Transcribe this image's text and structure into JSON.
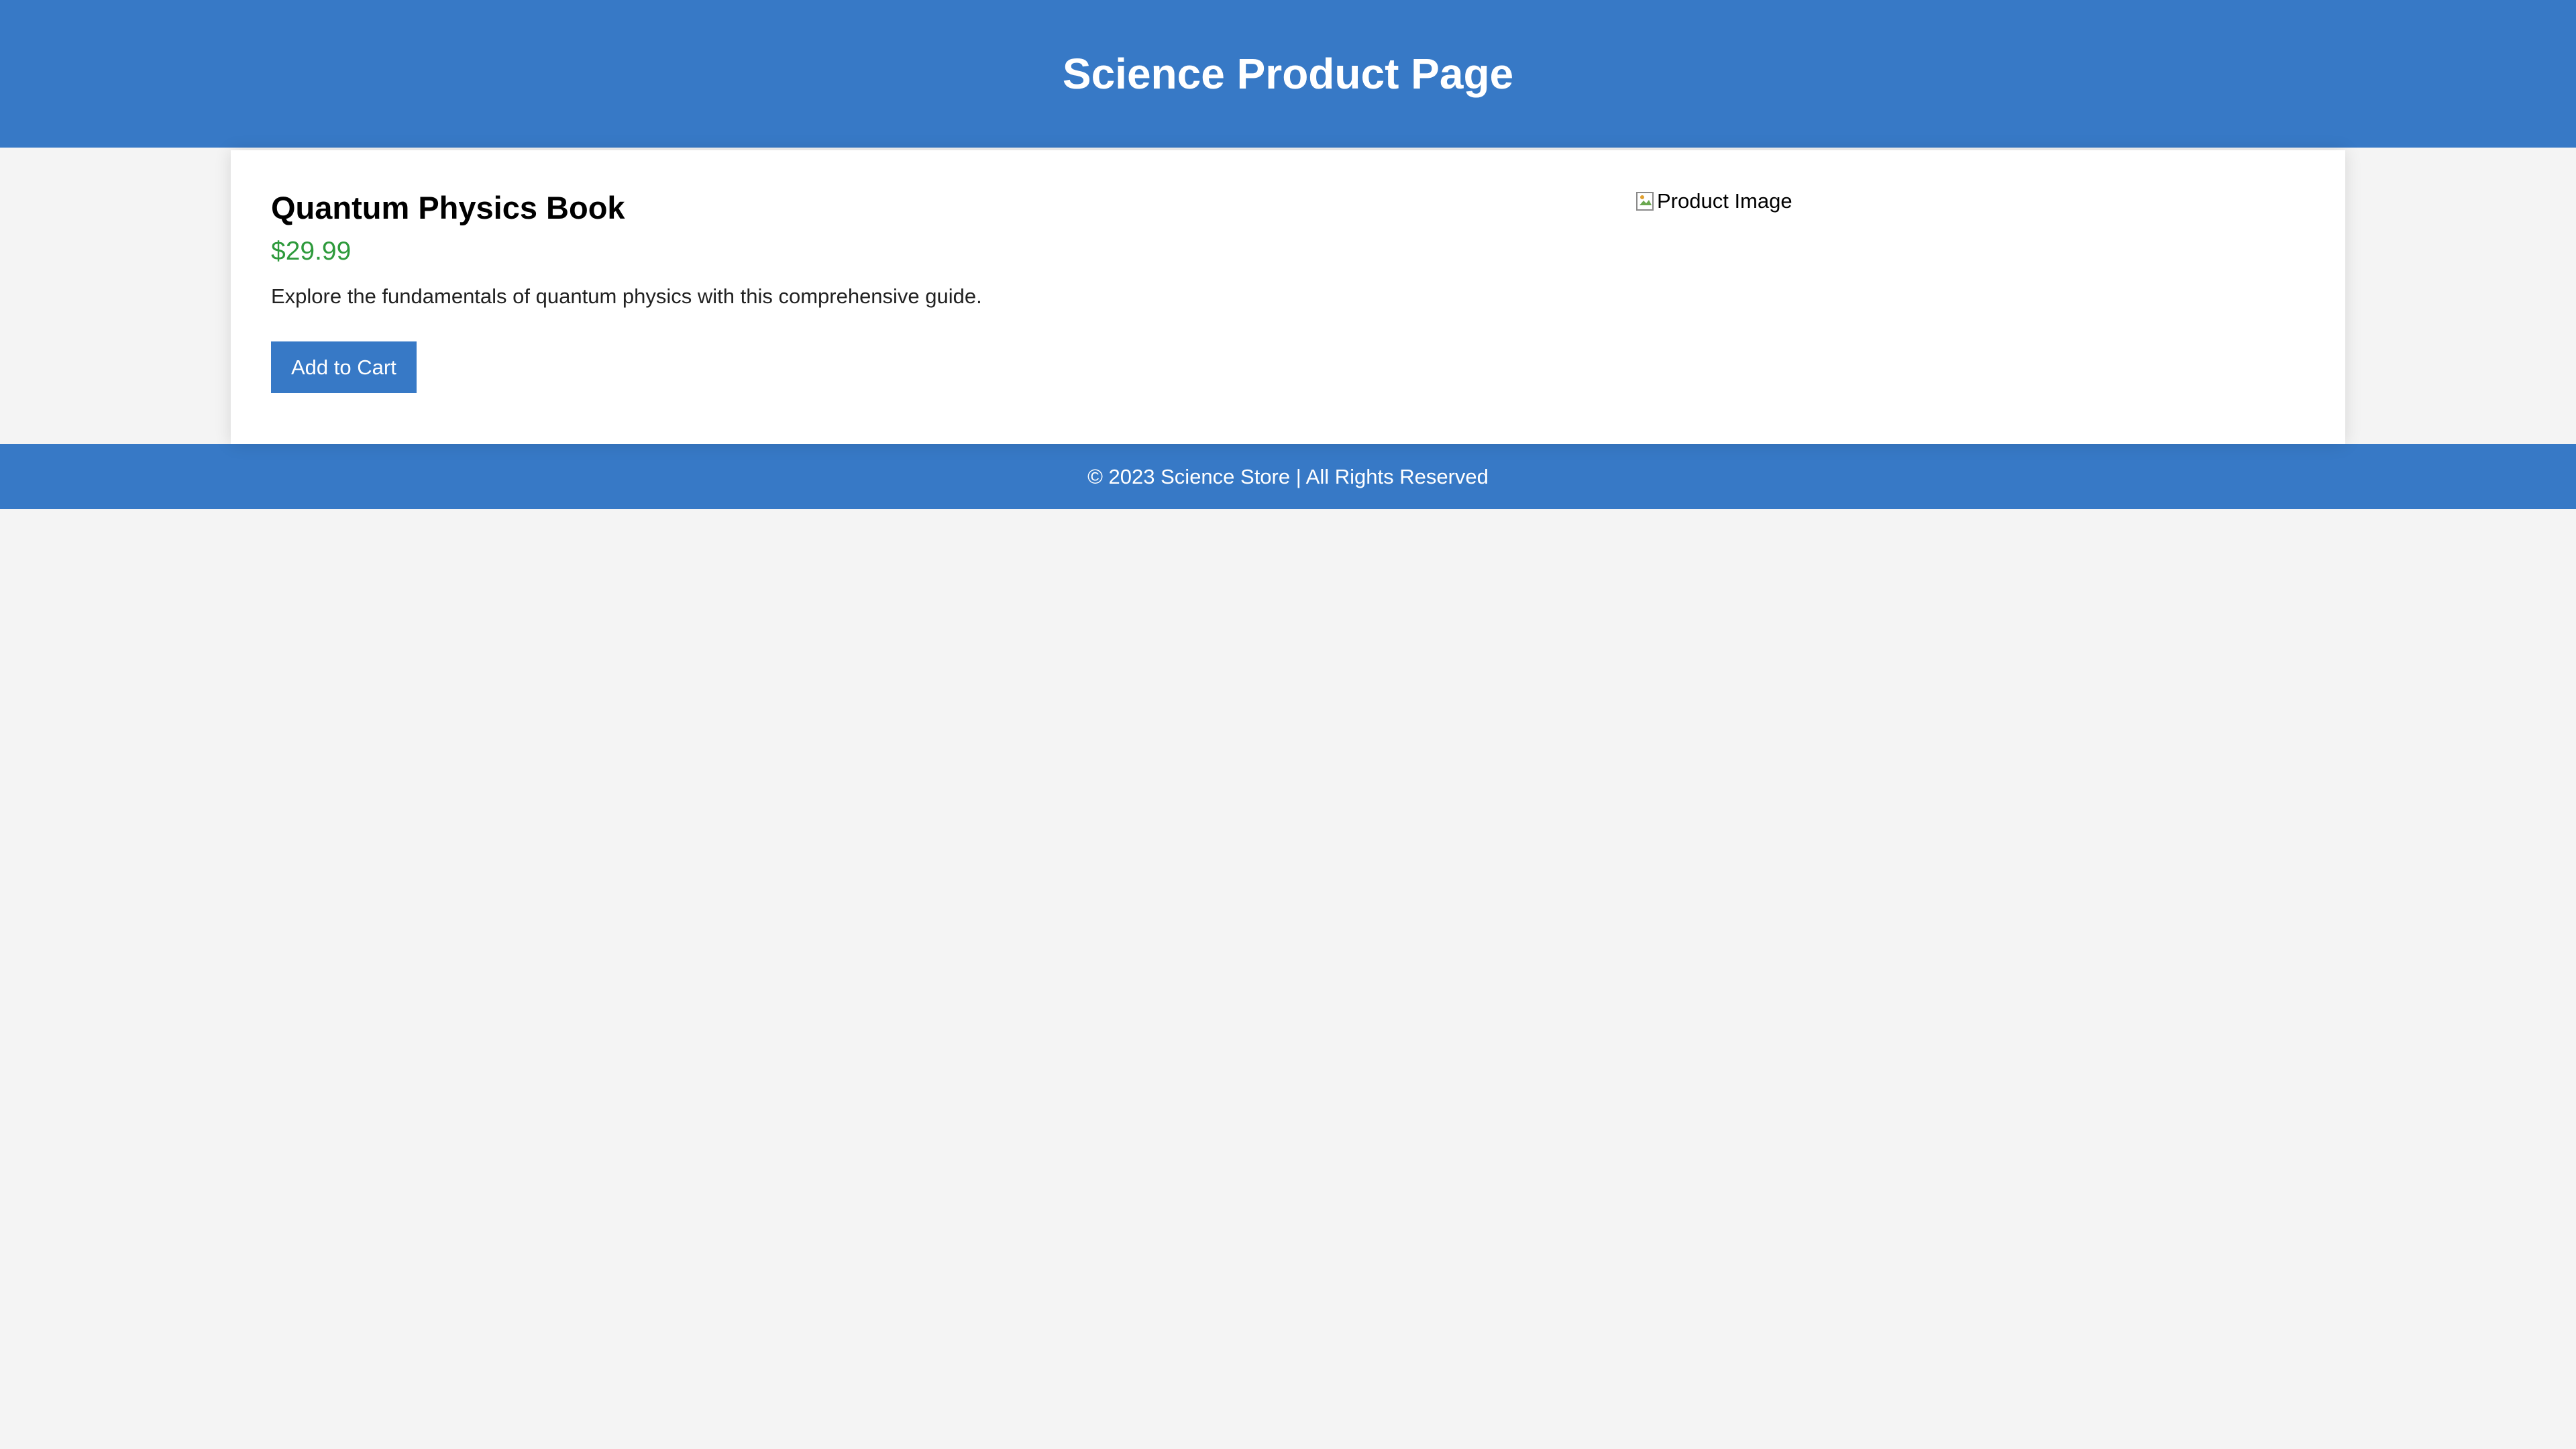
{
  "header": {
    "title": "Science Product Page"
  },
  "product": {
    "title": "Quantum Physics Book",
    "price": "$29.99",
    "description": "Explore the fundamentals of quantum physics with this comprehensive guide.",
    "add_to_cart_label": "Add to Cart",
    "image_alt": "Product Image"
  },
  "footer": {
    "text": "© 2023 Science Store | All Rights Reserved"
  },
  "colors": {
    "brand": "#3779c6",
    "price": "#2e9a3c",
    "background": "#f4f4f4"
  },
  "icons": {
    "broken_image": "broken-image-icon"
  }
}
